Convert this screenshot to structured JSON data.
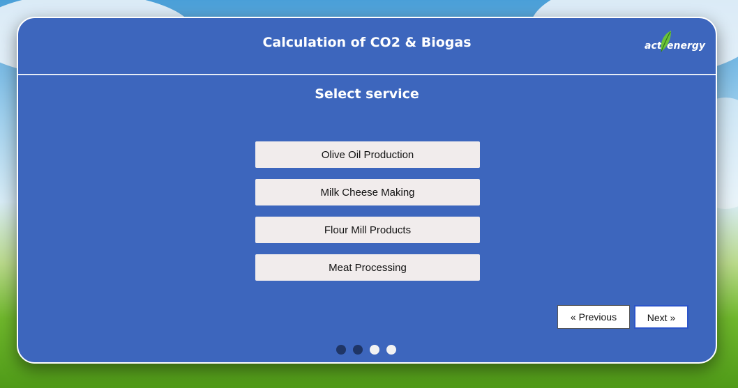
{
  "header": {
    "title": "Calculation of CO2 & Biogas"
  },
  "logo": {
    "part1": "act",
    "part2": "energy",
    "leaf_color": "#6bc23a"
  },
  "main": {
    "subtitle": "Select service",
    "options": [
      {
        "label": "Olive Oil Production"
      },
      {
        "label": "Milk Cheese Making"
      },
      {
        "label": "Flour Mill Products"
      },
      {
        "label": "Meat Processing"
      }
    ]
  },
  "nav": {
    "previous_label": "« Previous",
    "next_label": "Next »"
  },
  "progress": {
    "steps": 4,
    "current": 2,
    "active_color": "#1f3566",
    "inactive_color": "#f2f2f2"
  },
  "colors": {
    "panel": "#3d66bd",
    "option_bg": "#f1ecec",
    "text_light": "#ffffff"
  }
}
